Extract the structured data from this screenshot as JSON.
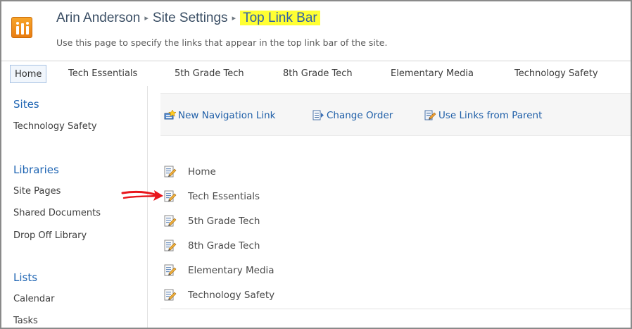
{
  "header": {
    "breadcrumb": [
      "Arin Anderson",
      "Site Settings",
      "Top Link Bar"
    ],
    "separator": "▸",
    "description": "Use this page to specify the links that appear in the top link bar of the site."
  },
  "topnav": {
    "items": [
      "Home",
      "Tech Essentials",
      "5th Grade Tech",
      "8th Grade Tech",
      "Elementary Media",
      "Technology Safety"
    ],
    "selected": "Home"
  },
  "leftnav": {
    "sites_heading": "Sites",
    "sites_items": [
      "Technology Safety"
    ],
    "libraries_heading": "Libraries",
    "libraries_items": [
      "Site Pages",
      "Shared Documents",
      "Drop Off Library"
    ],
    "lists_heading": "Lists",
    "lists_items": [
      "Calendar",
      "Tasks"
    ]
  },
  "toolbar": {
    "new_link": "New Navigation Link",
    "change_order": "Change Order",
    "use_parent": "Use Links from Parent"
  },
  "links": [
    "Home",
    "Tech Essentials",
    "5th Grade Tech",
    "8th Grade Tech",
    "Elementary Media",
    "Technology Safety"
  ],
  "colors": {
    "accent": "#1f65b3",
    "highlight": "#ffff33",
    "arrow": "#e8161c"
  },
  "icons": {
    "site_logo": "sharepoint-site-icon",
    "new_link": "new-navigation-link-icon",
    "change_order": "change-order-icon",
    "use_parent": "use-links-from-parent-icon",
    "link_item": "edit-link-icon",
    "annotation": "red-arrow-icon"
  }
}
